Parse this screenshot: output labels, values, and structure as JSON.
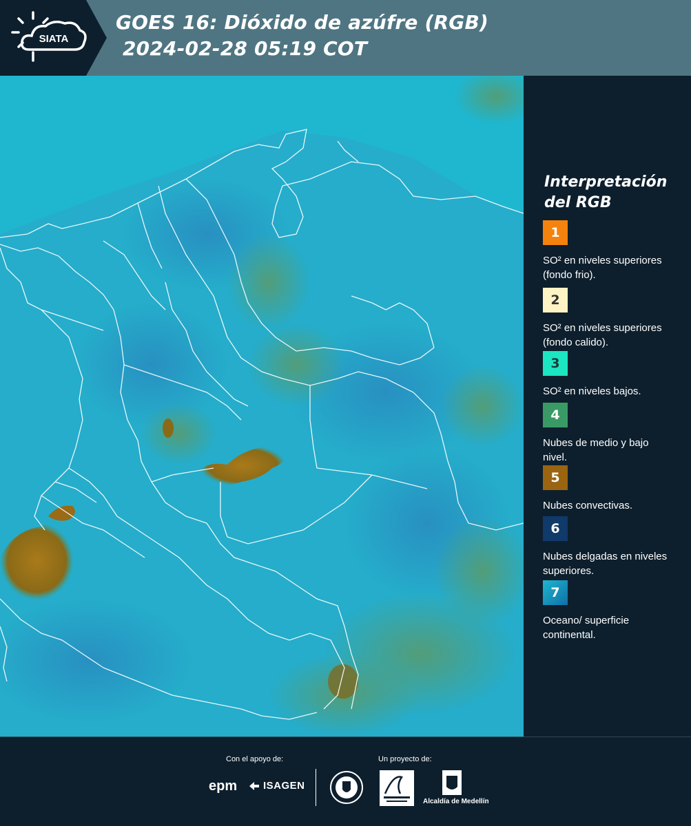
{
  "header": {
    "logo_text": "SIATA",
    "title_line1": "GOES 16: Dióxido de azúfre (RGB)",
    "title_line2": "2024-02-28 05:19 COT"
  },
  "map": {
    "ocean_color": "#1fb6cf",
    "land_color": "#2aa6c9",
    "border_color": "#ffffff"
  },
  "legend": {
    "title": "Interpretación del RGB",
    "items": [
      {
        "number": "1",
        "color": "#f5820d",
        "text_color": "#ffffff",
        "label": "SO² en niveles superiores (fondo frio)."
      },
      {
        "number": "2",
        "color": "#fdf3c4",
        "text_color": "#333333",
        "label": "SO² en niveles superiores (fondo calido)."
      },
      {
        "number": "3",
        "color": "#1be6c1",
        "text_color": "#1b3a3a",
        "label": "SO² en niveles bajos."
      },
      {
        "number": "4",
        "color": "#3a9a66",
        "text_color": "#ffffff",
        "label": "Nubes de medio y bajo nivel."
      },
      {
        "number": "5",
        "color": "#9a6410",
        "text_color": "#ffffff",
        "label": "Nubes convectivas."
      },
      {
        "number": "6",
        "color": "#0f3a6a",
        "text_color": "#ffffff",
        "label": "Nubes delgadas en niveles superiores."
      },
      {
        "number": "7",
        "color": "#1397c6",
        "text_color": "#ffffff",
        "label": "Oceano/ superficie continental."
      }
    ]
  },
  "footer": {
    "support_label": "Con el apoyo de:",
    "project_label": "Un proyecto de:",
    "epm": "epm",
    "isagen": "ISAGEN",
    "area_logo": "Área Metropolitana Valle de Aburrá",
    "alcaldia": "Alcaldía de Medellín"
  }
}
